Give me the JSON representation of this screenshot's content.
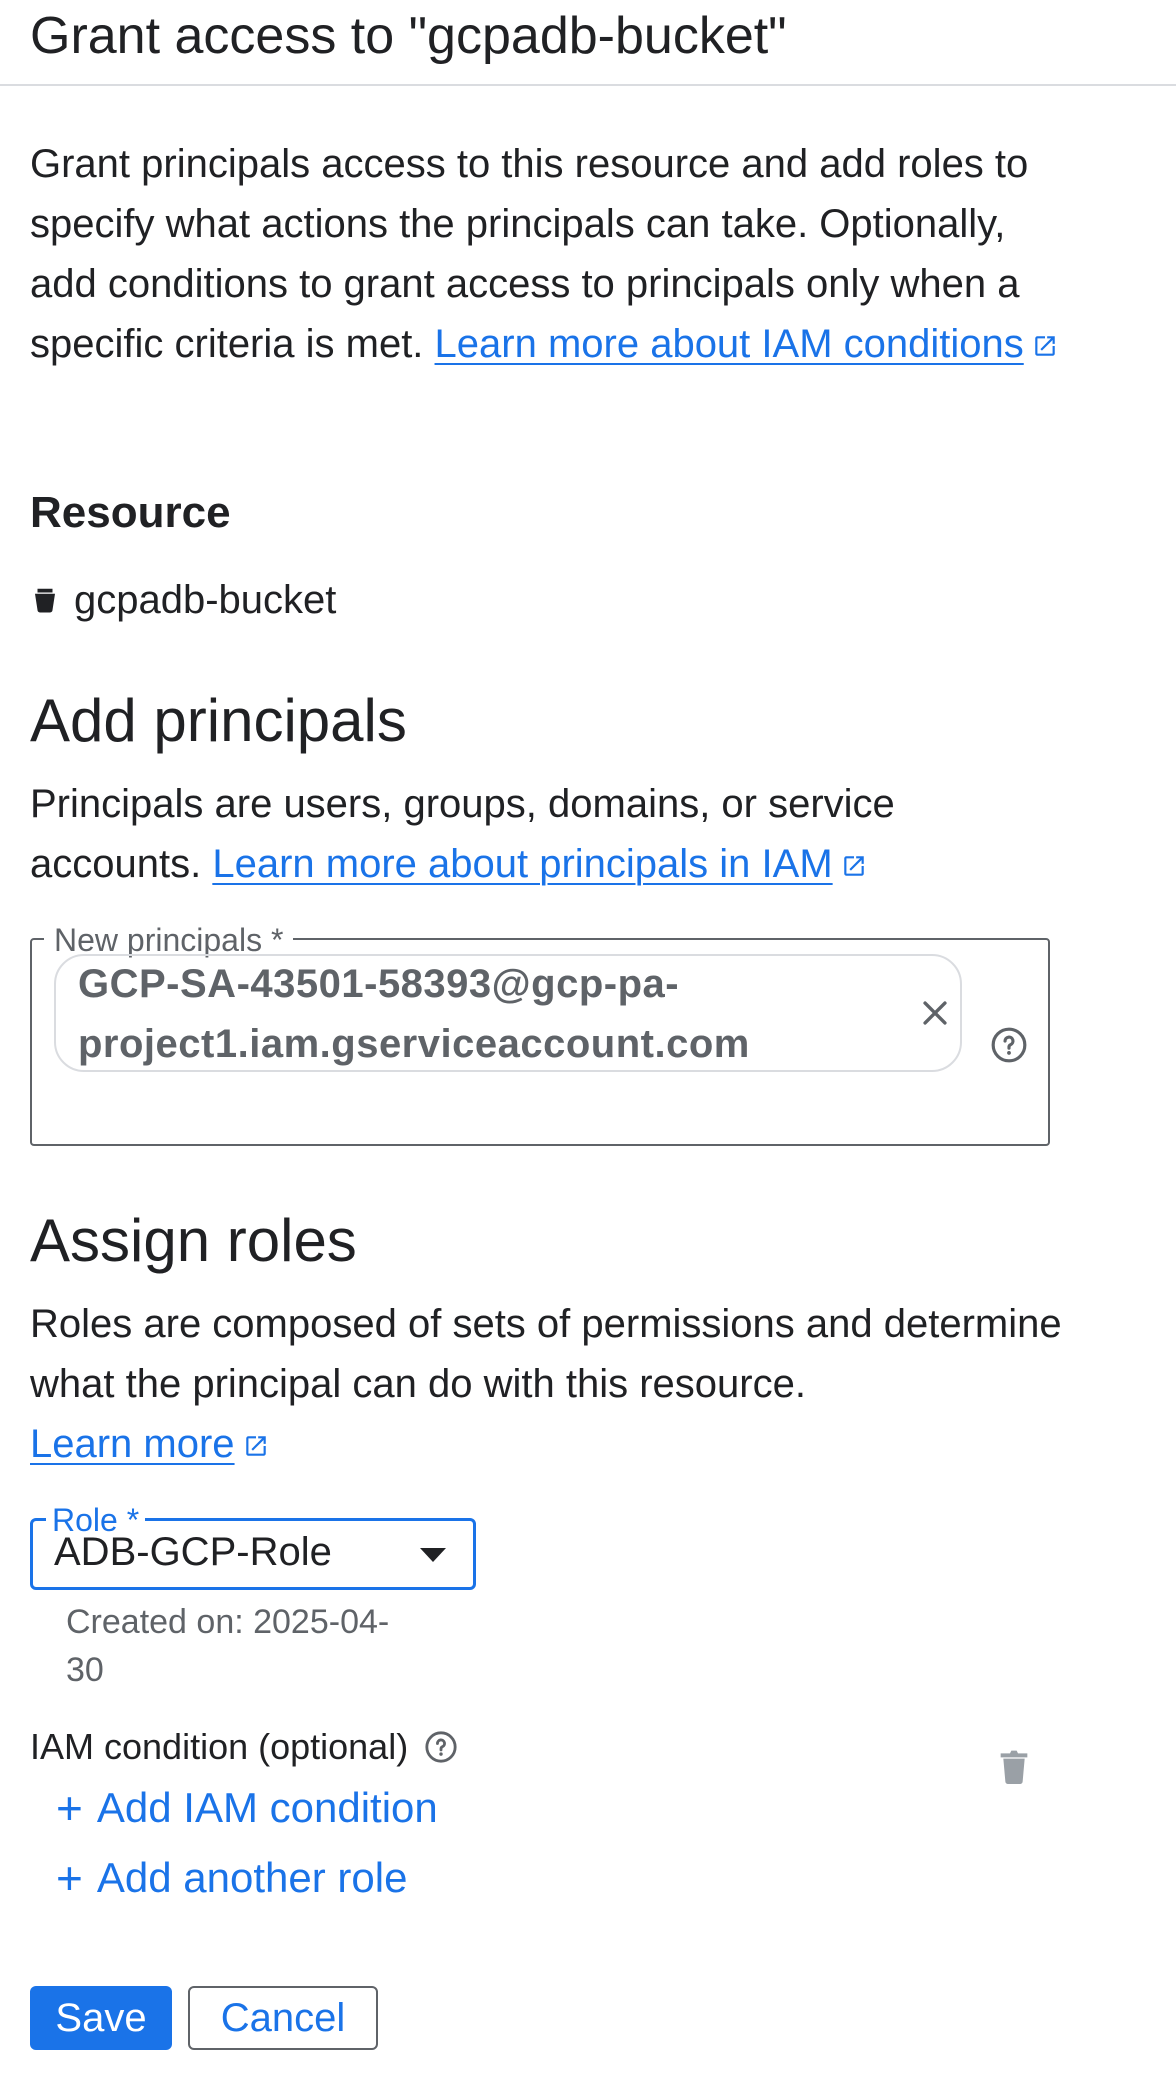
{
  "panel": {
    "title": "Grant access to \"gcpadb-bucket\""
  },
  "intro": {
    "text": "Grant principals access to this resource and add roles to specify what actions the principals can take. Optionally, add conditions to grant access to principals only when a specific criteria is met. ",
    "link": "Learn more about IAM conditions"
  },
  "resource": {
    "heading": "Resource",
    "icon": "bucket-icon",
    "name": "gcpadb-bucket"
  },
  "add_principals": {
    "heading": "Add principals",
    "description": "Principals are users, groups, domains, or service accounts. ",
    "link": "Learn more about principals in IAM",
    "field_label": "New principals *",
    "chip_value": "GCP-SA-43501-58393@gcp-pa-project1.iam.gserviceaccount.com"
  },
  "assign_roles": {
    "heading": "Assign roles",
    "description": "Roles are composed of sets of permissions and determine what the principal can do with this resource.",
    "link": "Learn more",
    "role_label": "Role *",
    "role_value": "ADB-GCP-Role",
    "created_on": "Created on: 2025-04-30",
    "iam_condition_label": "IAM condition (optional)",
    "add_condition": "Add IAM condition",
    "add_role": "Add another role"
  },
  "actions": {
    "save": "Save",
    "cancel": "Cancel"
  },
  "colors": {
    "accent": "#1a73e8",
    "text": "#202124",
    "muted": "#5f6368"
  }
}
